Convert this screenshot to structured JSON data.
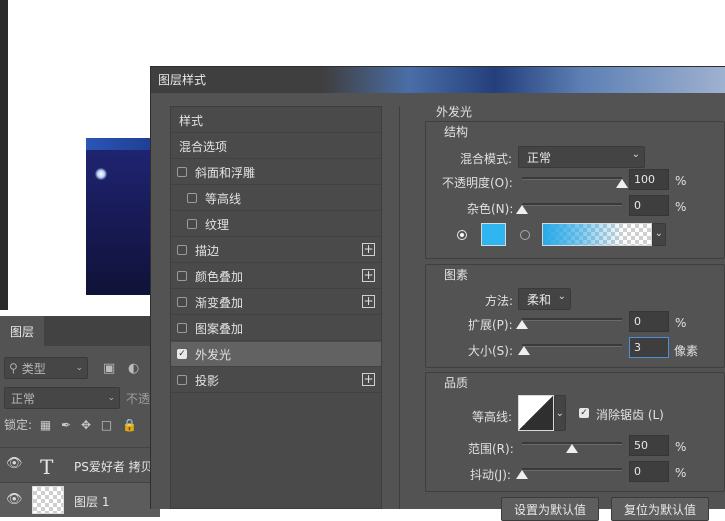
{
  "canvas": {},
  "layers_panel": {
    "tab_label": "图层",
    "filter_label": "类型",
    "blend_mode": "正常",
    "opacity_label": "不透",
    "lock_label": "锁定:",
    "layers": [
      {
        "name": "PS爱好者 拷贝",
        "type": "text",
        "thumb_glyph": "T"
      },
      {
        "name": "图层 1",
        "type": "image"
      }
    ]
  },
  "dialog": {
    "title": "图层样式",
    "styles": [
      {
        "label": "样式",
        "checkbox": false
      },
      {
        "label": "混合选项",
        "checkbox": false
      },
      {
        "label": "斜面和浮雕",
        "checkbox": true,
        "checked": false
      },
      {
        "label": "等高线",
        "checkbox": true,
        "checked": false,
        "indent": true
      },
      {
        "label": "纹理",
        "checkbox": true,
        "checked": false,
        "indent": true
      },
      {
        "label": "描边",
        "checkbox": true,
        "checked": false,
        "plus": true
      },
      {
        "label": "颜色叠加",
        "checkbox": true,
        "checked": false,
        "plus": true
      },
      {
        "label": "渐变叠加",
        "checkbox": true,
        "checked": false,
        "plus": true
      },
      {
        "label": "图案叠加",
        "checkbox": true,
        "checked": false
      },
      {
        "label": "外发光",
        "checkbox": true,
        "checked": true,
        "active": true
      },
      {
        "label": "投影",
        "checkbox": true,
        "checked": false,
        "plus": true
      }
    ],
    "outer_glow": {
      "title": "外发光",
      "structure": {
        "title": "结构",
        "blend_mode_label": "混合模式:",
        "blend_mode_value": "正常",
        "opacity_label": "不透明度(O):",
        "opacity_value": "100",
        "opacity_level": 1.0,
        "noise_label": "杂色(N):",
        "noise_value": "0",
        "noise_level": 0.0,
        "percent": "%",
        "color_swatch": "#2fb6f0"
      },
      "elements": {
        "title": "图素",
        "technique_label": "方法:",
        "technique_value": "柔和",
        "spread_label": "扩展(P):",
        "spread_value": "0",
        "spread_level": 0.0,
        "size_label": "大小(S):",
        "size_value": "3",
        "size_level": 0.02,
        "size_unit": "像素",
        "percent": "%"
      },
      "quality": {
        "title": "品质",
        "contour_label": "等高线:",
        "anti_alias_label": "消除锯齿 (L)",
        "anti_alias_checked": true,
        "range_label": "范围(R):",
        "range_value": "50",
        "range_level": 0.5,
        "jitter_label": "抖动(J):",
        "jitter_value": "0",
        "jitter_level": 0.0,
        "percent": "%"
      },
      "buttons": {
        "make_default": "设置为默认值",
        "reset_default": "复位为默认值"
      }
    }
  }
}
